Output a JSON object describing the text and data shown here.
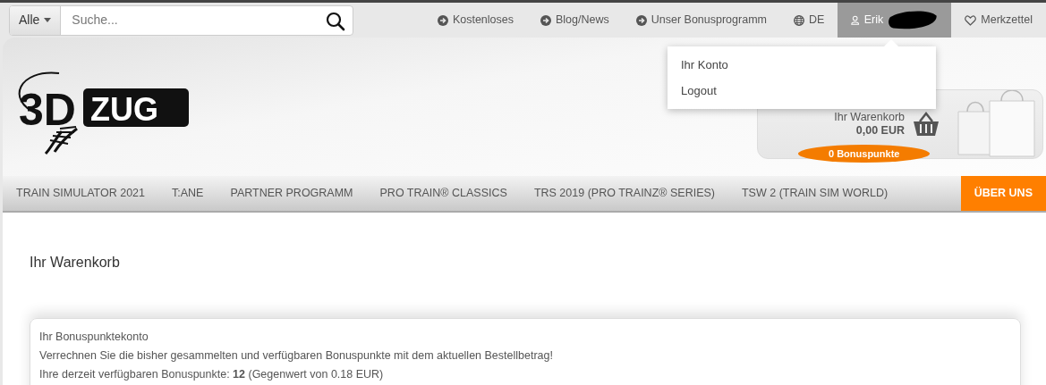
{
  "search": {
    "category": "Alle",
    "placeholder": "Suche..."
  },
  "top_links": [
    {
      "kind": "arrow",
      "label": "Kostenloses",
      "active": false
    },
    {
      "kind": "arrow",
      "label": "Blog/News",
      "active": false
    },
    {
      "kind": "arrow",
      "label": "Unser Bonusprogramm",
      "active": false
    },
    {
      "kind": "globe",
      "label": "DE",
      "active": false
    },
    {
      "kind": "user",
      "label": "Erik",
      "active": true
    },
    {
      "kind": "heart",
      "label": "Merkzettel",
      "active": false
    }
  ],
  "account_menu": [
    "Ihr Konto",
    "Logout"
  ],
  "logo": {
    "part_1": "3D",
    "part_2": "ZUG"
  },
  "cart": {
    "label": "Ihr Warenkorb",
    "amount": "0,00 EUR",
    "points_badge": "0 Bonuspunkte"
  },
  "main_nav": [
    {
      "label": "TRAIN SIMULATOR 2021",
      "highlighted": false
    },
    {
      "label": "T:ANE",
      "highlighted": false
    },
    {
      "label": "PARTNER PROGRAMM",
      "highlighted": false
    },
    {
      "label": "PRO TRAIN® CLASSICS",
      "highlighted": false
    },
    {
      "label": "TRS 2019 (PRO TRAINZ® SERIES)",
      "highlighted": false
    },
    {
      "label": "TSW 2 (TRAIN SIM WORLD)",
      "highlighted": false
    },
    {
      "label": "ÜBER UNS",
      "highlighted": true
    }
  ],
  "page_title": "Ihr Warenkorb",
  "bonus_box": {
    "title": "Ihr Bonuspunktekonto",
    "text": "Verrechnen Sie die bisher gesammelten und verfügbaren Bonuspunkte mit dem aktuellen Bestellbetrag!",
    "available": "Ihre derzeit verfügbaren Bonuspunkte: **12** (Gegenwert von 0.18 EUR)"
  }
}
